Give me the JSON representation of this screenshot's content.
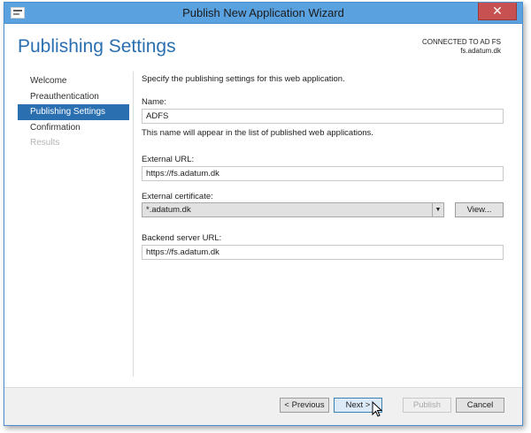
{
  "window": {
    "title": "Publish New Application Wizard",
    "close_glyph": "✕"
  },
  "header": {
    "title": "Publishing Settings",
    "connection_status": "CONNECTED TO AD FS",
    "server": "fs.adatum.dk"
  },
  "nav": {
    "items": [
      {
        "label": "Welcome",
        "state": "normal"
      },
      {
        "label": "Preauthentication",
        "state": "normal"
      },
      {
        "label": "Publishing Settings",
        "state": "active"
      },
      {
        "label": "Confirmation",
        "state": "normal"
      },
      {
        "label": "Results",
        "state": "disabled"
      }
    ]
  },
  "form": {
    "intro": "Specify the publishing settings for this web application.",
    "name_label": "Name:",
    "name_value": "ADFS",
    "name_hint": "This name will appear in the list of published web applications.",
    "external_url_label": "External URL:",
    "external_url_value": "https://fs.adatum.dk",
    "certificate_label": "External certificate:",
    "certificate_value": "*.adatum.dk",
    "view_button": "View...",
    "backend_url_label": "Backend server URL:",
    "backend_url_value": "https://fs.adatum.dk"
  },
  "footer": {
    "previous": "< Previous",
    "next": "Next >",
    "publish": "Publish",
    "cancel": "Cancel"
  },
  "colors": {
    "titlebar": "#5aa1e0",
    "accent": "#2a6fb0",
    "close": "#c75050"
  }
}
